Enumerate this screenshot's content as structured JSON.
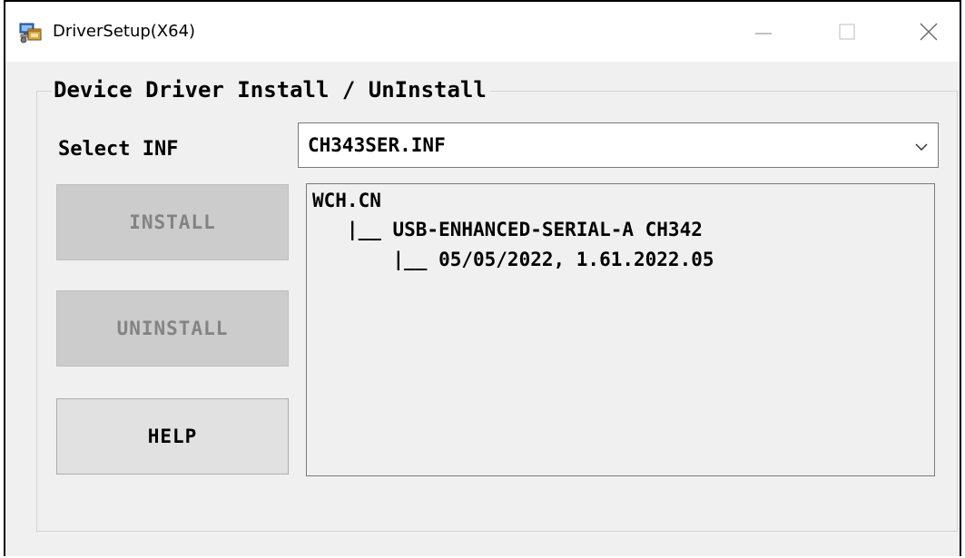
{
  "window": {
    "title": "DriverSetup(X64)",
    "app_icon": "installer-computer-icon",
    "controls": {
      "minimize": "minimize-icon",
      "maximize": "maximize-icon",
      "close": "close-icon"
    }
  },
  "group": {
    "legend": "Device Driver Install / UnInstall"
  },
  "inf": {
    "label": "Select INF",
    "selected": "CH343SER.INF"
  },
  "buttons": {
    "install": "INSTALL",
    "uninstall": "UNINSTALL",
    "help": "HELP",
    "install_enabled": false,
    "uninstall_enabled": false,
    "help_enabled": true
  },
  "info": {
    "lines": [
      "WCH.CN",
      "   |__ USB-ENHANCED-SERIAL-A CH342",
      "       |__ 05/05/2022, 1.61.2022.05"
    ]
  },
  "colors": {
    "window_bg": "#f0f0f0",
    "disabled_button_bg": "#cccccc",
    "disabled_text": "#838383"
  }
}
